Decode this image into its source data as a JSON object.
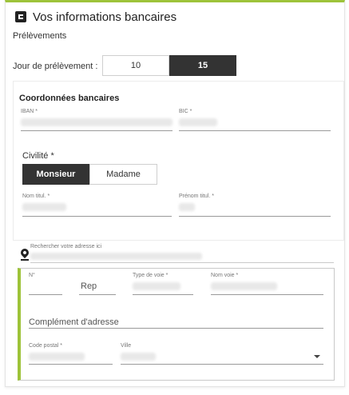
{
  "header": {
    "title": "Vos informations bancaires",
    "icon": "bank-card-icon",
    "accent_color": "#9ec33a"
  },
  "prelevements": {
    "subtitle": "Prélèvements",
    "day_label": "Jour de prélèvement :",
    "options": [
      "10",
      "15"
    ],
    "selected": "15"
  },
  "bank": {
    "section_title": "Coordonnées bancaires",
    "iban_label": "IBAN *",
    "bic_label": "BIC *",
    "civilite_label": "Civilité *",
    "civilite_options": [
      "Monsieur",
      "Madame"
    ],
    "civilite_selected": "Monsieur",
    "nom_label": "Nom titul. *",
    "prenom_label": "Prénom titul. *"
  },
  "address": {
    "search_label": "Rechercher votre adresse ici",
    "search_icon": "location-pin-icon",
    "numero_label": "N°",
    "rep_placeholder": "Rep",
    "type_voie_label": "Type de voie *",
    "nom_voie_label": "Nom voie *",
    "complement_placeholder": "Complément d'adresse",
    "code_postal_label": "Code postal *",
    "ville_label": "Ville"
  }
}
